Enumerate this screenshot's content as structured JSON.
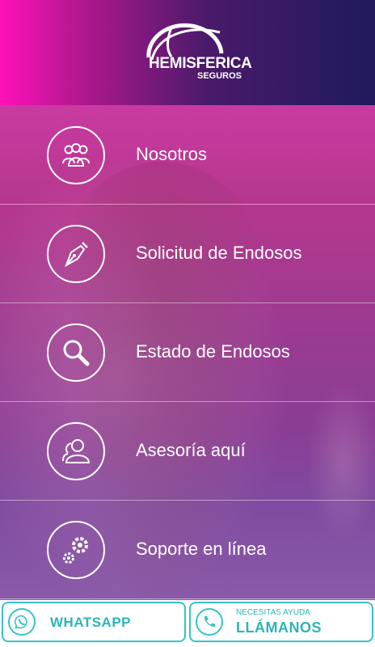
{
  "header": {
    "logo_title": "HEMISFERICA",
    "logo_subtitle": "SEGUROS",
    "colors": {
      "gradient_start": "#ff10b8",
      "gradient_end": "#1f1a5c"
    }
  },
  "menu": {
    "items": [
      {
        "label": "Nosotros",
        "icon": "group-icon"
      },
      {
        "label": "Solicitud de Endosos",
        "icon": "pen-nib-icon"
      },
      {
        "label": "Estado de Endosos",
        "icon": "magnifier-icon"
      },
      {
        "label": "Asesoría aquí",
        "icon": "advisor-users-icon"
      },
      {
        "label": "Soporte en línea",
        "icon": "gears-icon"
      }
    ]
  },
  "bottom_bar": {
    "whatsapp_label": "WHATSAPP",
    "call_small": "NECESITAS AYUDA",
    "call_big": "LLÁMANOS",
    "accent_color": "#36c2c6"
  }
}
